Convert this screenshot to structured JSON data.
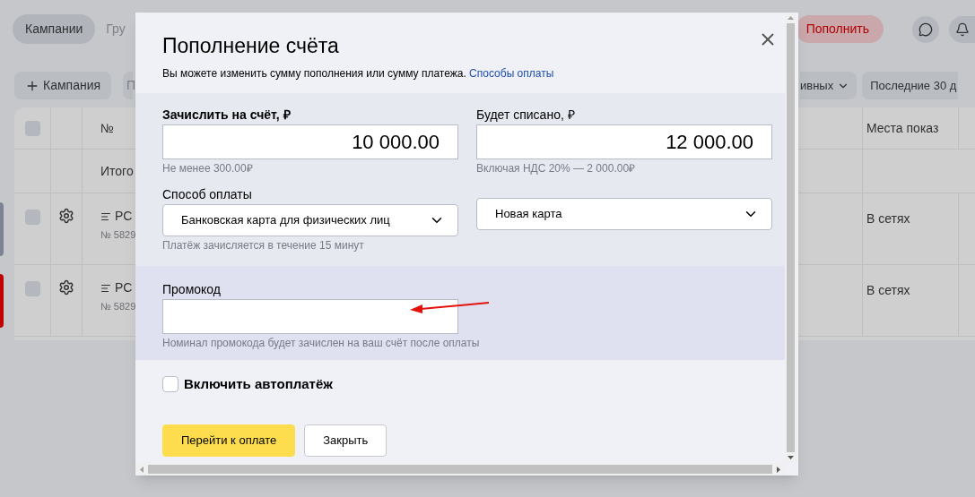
{
  "top_bar": {
    "tabs": [
      {
        "label": "Кампании",
        "selected": true
      },
      {
        "label": "Гру",
        "selected": false
      }
    ],
    "topup_button": "Пополнить"
  },
  "toolbar": {
    "add_button": "Кампания",
    "button_2": "П",
    "filter_button": "ивных",
    "period_button": "Последние 30 д"
  },
  "table": {
    "header_checked": false,
    "columns": [
      "№",
      "Места показ"
    ],
    "total_label": "Итого",
    "rows": [
      {
        "title": "РС",
        "number": "№ 5829",
        "placement": "В сетях",
        "checked": false,
        "color": "#7d8491"
      },
      {
        "title": "РС",
        "number": "№ 5829",
        "placement": "В сетях",
        "checked": false,
        "color": "#c00000"
      }
    ]
  },
  "modal": {
    "title": "Пополнение счёта",
    "subtitle": "Вы можете изменить сумму пополнения или сумму платежа.",
    "subtitle_link": "Способы оплаты",
    "credit": {
      "label": "Зачислить на счёт, ₽",
      "value": "10 000.00",
      "hint": "Не менее 300.00₽"
    },
    "charge": {
      "label": "Будет списано, ₽",
      "value": "12 000.00",
      "hint": "Включая НДС 20% — 2 000.00₽"
    },
    "payment": {
      "label": "Способ оплаты",
      "method": "Банковская карта для физических лиц",
      "card": "Новая карта",
      "hint": "Платёж зачисляется в течение 15 минут"
    },
    "promo": {
      "label": "Промокод",
      "hint": "Номинал промокода будет зачислен на ваш счёт после оплаты"
    },
    "autopay": {
      "label": "Включить автоплатёж",
      "checked": false
    },
    "buttons": [
      {
        "label": "Перейти к оплате",
        "kind": "primary"
      },
      {
        "label": "Закрыть",
        "kind": "secondary"
      }
    ]
  }
}
